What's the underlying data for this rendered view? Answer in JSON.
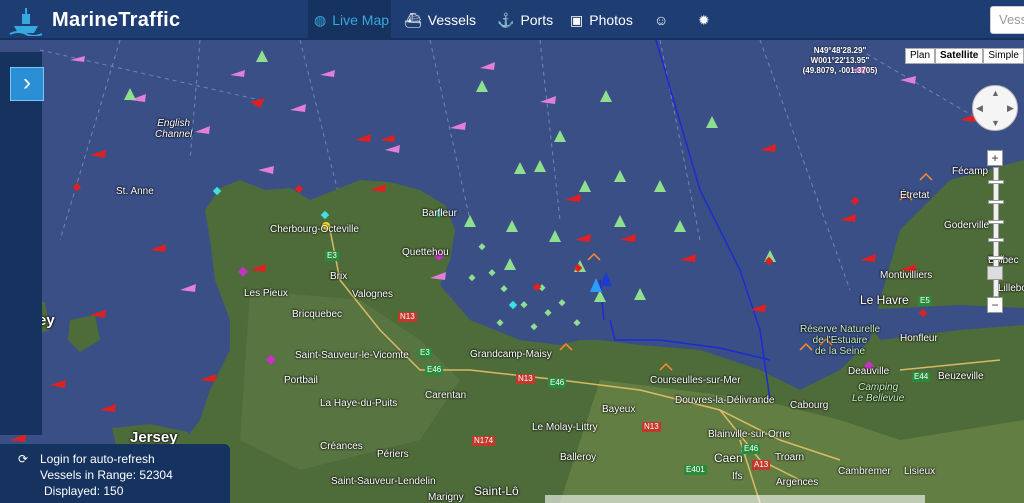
{
  "header": {
    "brand": "MarineTraffic",
    "nav": [
      {
        "label": "Live Map",
        "icon": "globe-icon"
      },
      {
        "label": "Vessels",
        "icon": "ship-icon"
      },
      {
        "label": "Ports",
        "icon": "anchor-icon"
      },
      {
        "label": "Photos",
        "icon": "camera-icon"
      },
      {
        "label": "",
        "icon": "users-icon"
      },
      {
        "label": "",
        "icon": "gear-icon"
      }
    ],
    "search_placeholder": "Vesse"
  },
  "map": {
    "coords": {
      "lat": "N49°48'28.29\"",
      "lon": "W001°22'13.95\"",
      "decimal": "(49.8079, -001.3705)"
    },
    "map_types": [
      "Plan",
      "Satellite",
      "Simple"
    ],
    "selected_map_type": "Satellite",
    "zoom_level_fraction": 0.9,
    "labels": {
      "english_channel": "English\nChannel",
      "st_anne": "St. Anne",
      "cherbourg": "Cherbourg-Octeville",
      "barfleur": "Barfleur",
      "quettehou": "Quettehou",
      "brix": "Brix",
      "valognes": "Valognes",
      "les_pieux": "Les Pieux",
      "bricquebec": "Bricquebec",
      "sauveur": "Saint-Sauveur-le-Vicomte",
      "portbail": "Portbail",
      "haye": "La Haye-du-Puits",
      "grandcamp": "Grandcamp-Maisy",
      "carentan": "Carentan",
      "courseulles": "Courseulles-sur-Mer",
      "douvres": "Douvres-la-Délivrande",
      "bayeux": "Bayeux",
      "cabourg": "Cabourg",
      "molay": "Le Molay-Littry",
      "creances": "Créances",
      "periers": "Périers",
      "lendelin": "Saint-Sauveur-Lendelin",
      "balleroy": "Balleroy",
      "blainville": "Blainville-sur-Orne",
      "caen": "Caen",
      "troarn": "Troarn",
      "argences": "Argences",
      "cambremer": "Cambremer",
      "lisieux": "Lisieux",
      "marigny": "Marigny",
      "saint_lo": "Saint-Lô",
      "ifs": "Ifs",
      "jersey": "Jersey",
      "montivilliers": "Montivilliers",
      "le_havre": "Le Havre",
      "honfleur": "Honfleur",
      "deauville": "Deauville",
      "beuzeville": "Beuzeville",
      "fecamp": "Fécamp",
      "etretat": "Étretat",
      "goderville": "Goderville",
      "bolbec": "Bolbec",
      "lillebonne": "Lillebo",
      "reserve": "Réserve Naturelle\nde l'Estuaire\nde la Seine",
      "camping": "Camping\nLe Bellevue",
      "ey": "ey"
    },
    "roads": [
      "E3",
      "N13",
      "E3",
      "E46",
      "N13",
      "E46",
      "N174",
      "N13",
      "E401",
      "A13",
      "E46",
      "E44",
      "E5"
    ]
  },
  "status": {
    "login_text": "Login for auto-refresh",
    "vessels_label": "Vessels in Range:",
    "vessels_value": "52304",
    "displayed_label": "Displayed:",
    "displayed_value": "150"
  },
  "colors": {
    "navbar": "#1d3d73",
    "active": "#37a9e1",
    "sea": "#3a4f86",
    "land": "#4e6b3a",
    "cargo": "#e4a3b0",
    "tanker": "#e02020",
    "passenger": "#2e9cff",
    "fishing": "#ff8c2a",
    "pleasure": "#c830c8",
    "highspeed": "#8ee08e"
  }
}
